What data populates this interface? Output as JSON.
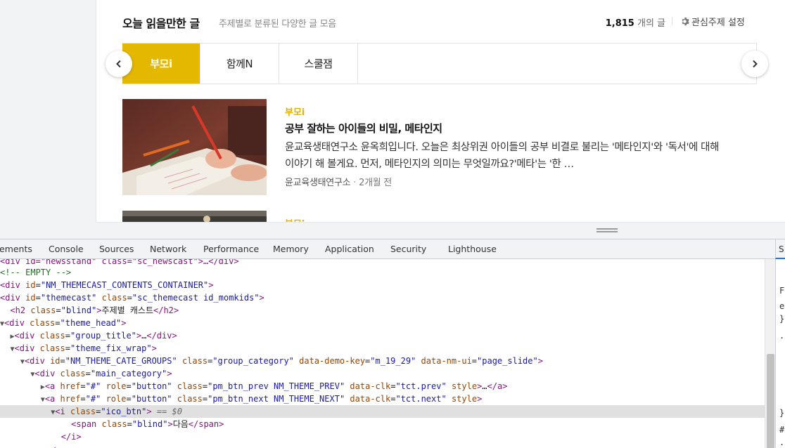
{
  "themecast": {
    "title": "오늘 읽을만한 글",
    "subtitle": "주제별로 분류된 다양한 글 모음",
    "count": "1,815",
    "count_unit": "개의 글",
    "setting_label": "관심주제 설정",
    "tabs": [
      {
        "label": "부모i",
        "active": true
      },
      {
        "label": "함께N",
        "active": false
      },
      {
        "label": "스쿨잼",
        "active": false
      }
    ],
    "articles": [
      {
        "category": "부모i",
        "title": "공부 잘하는 아이들의 비밀, 메타인지",
        "body": "윤교육생태연구소 윤옥희입니다. 오늘은 최상위권 아이들의 공부 비결로 불리는 '메타인지'와 '독서'에 대해 이야기 해 볼게요. 먼저, 메타인지의 의미는 무엇일까요?'메타'는 '한 …",
        "source": "윤교육생태연구소",
        "time": "2개월 전"
      },
      {
        "category": "부모i"
      }
    ]
  },
  "devtools": {
    "tabs": [
      "ements",
      "Console",
      "Sources",
      "Network",
      "Performance",
      "Memory",
      "Application",
      "Security",
      "Lighthouse"
    ],
    "side_tab": "S",
    "lines": {
      "l0": "iv id=\"newsstand\" class=\"sc_newscast\">…</div>",
      "l1": "-- EMPTY -->",
      "l2_tag": "div",
      "l2_attr": "id",
      "l2_val": "\"NM_THEMECAST_CONTENTS_CONTAINER\"",
      "l3_tag": "div",
      "l3_a1": "id",
      "l3_v1": "\"themecast\"",
      "l3_a2": "class",
      "l3_v2": "\"sc_themecast id_momkids\"",
      "l4_text": "주제별 캐스트",
      "l5_v": "\"theme_head\"",
      "l6_v": "\"group_title\"",
      "l7_v": "\"theme_fix_wrap\"",
      "l8_id": "\"NM_THEME_CATE_GROUPS\"",
      "l8_class": "\"group_category\"",
      "l8_key": "\"m_19_29\"",
      "l8_ui": "\"page_slide\"",
      "l9_v": "\"main_category\"",
      "l10_class": "\"pm_btn_prev NM_THEME_PREV\"",
      "l10_clk": "\"tct.prev\"",
      "l11_class": "\"pm_btn_next NM_THEME_NEXT\"",
      "l11_clk": "\"tct.next\"",
      "l12_class": "\"ico_btn\"",
      "l12_eq": " == $0",
      "l13_class": "\"blind\"",
      "l13_text": "다음"
    },
    "side_chars": [
      "F",
      "e",
      "}",
      ".",
      "}",
      "#",
      "."
    ]
  }
}
